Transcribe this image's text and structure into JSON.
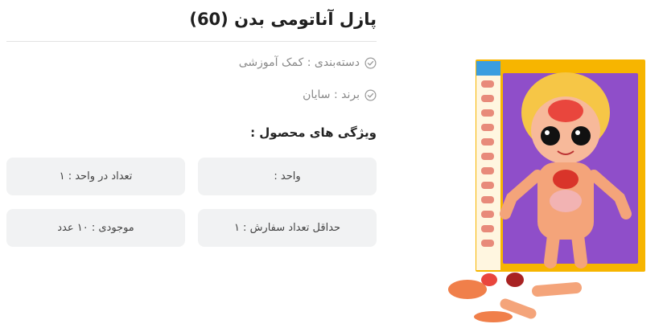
{
  "product": {
    "title": "پازل آناتومی بدن (60)",
    "category": "دسته‌بندی : کمک آموزشی",
    "brand": "برند : سایان",
    "features_title": "ویژگی های محصول :",
    "features": [
      "واحد :",
      "تعداد در واحد : ۱",
      "حداقل تعداد سفارش : ۱",
      "موجودی : ۱۰ عدد"
    ]
  },
  "icons": {
    "check": "check-circle-icon"
  },
  "colors": {
    "board_yellow": "#f7b500",
    "board_purple": "#8f4ec9",
    "skin": "#f4a47a",
    "hair": "#f6c646",
    "cell_bg": "#f1f2f3"
  }
}
